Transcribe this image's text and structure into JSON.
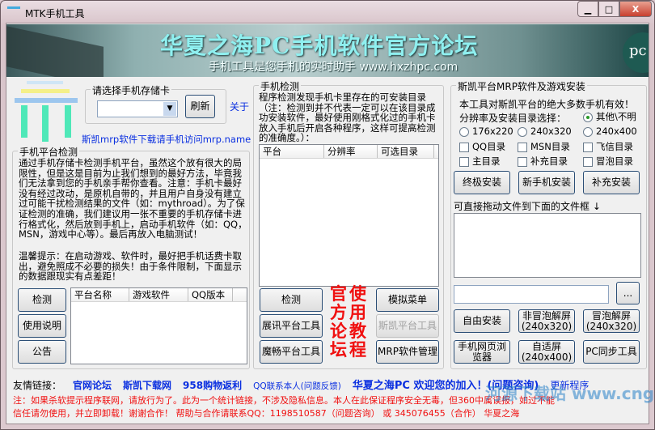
{
  "window": {
    "title": "MTK手机工具",
    "minimize": "▁",
    "maximize": "□",
    "close": "X"
  },
  "banner": {
    "title": "华夏之海PC手机软件官方论坛",
    "subtitle": "手机工具是您手机的实时助手 www.hxzhpc.com",
    "badge": "pc"
  },
  "storage": {
    "label": "请选择手机存储卡",
    "combo_value": "",
    "refresh": "刷新",
    "about": "关于",
    "mrp_link": "斯凯mrp软件下载请手机访问mrp.name"
  },
  "platform": {
    "label": "手机平台检测",
    "description": "通过手机存储卡检测手机平台，虽然这个放有很大的局限性，但是这是目前为止我们想到的最好方法，毕竟我们无法拿到您的手机亲手帮你查看。注意：手机卡最好没有经过改动，是原机自带的，并且用户自身没有建立过可能干扰检测结果的文件（如：mythroad）。为了保证检测的准确，我们建议用一张不重要的手机存储卡进行格式化，然后放到手机上，启动手机软件（如：QQ，MSN，游戏中心等）。最后再放入电脑测试！",
    "tip": "温馨提示：在启动游戏、软件时，最好把手机话费卡取出，避免照成不必要的损失！由于条件限制，下面显示的数据跟现实有点差距！",
    "buttons": [
      "检测",
      "使用说明",
      "公告"
    ],
    "columns": [
      "平台名称",
      "游戏软件",
      "QQ版本"
    ]
  },
  "detect": {
    "label": "手机检测",
    "description": "程序检测发现手机卡里存在的可安装目录（注：检测到并不代表一定可以在该目录成功安装软件，最好使用刚格式化过的手机卡放入手机后开启各种程序，这样可提高检测的准确度。）：",
    "columns": [
      "平台",
      "分辨率",
      "可选目录"
    ],
    "buttons": [
      "检测",
      "展讯平台工具",
      "魔畅平台工具"
    ],
    "tutorial_col1": "官方论坛",
    "tutorial_col2": "使用教程",
    "right_buttons": [
      "模拟菜单",
      "斯凯平台工具",
      "MRP软件管理"
    ]
  },
  "mrp": {
    "label": "斯凯平台MRP软件及游戏安装",
    "intro": "本工具对斯凯平台的绝大多数手机有效！",
    "res_label": "分辨率及安装目录选择：",
    "radios": [
      {
        "label": "其他\\不明",
        "checked": true
      },
      {
        "label": "176x220",
        "checked": false
      },
      {
        "label": "240x320",
        "checked": false
      },
      {
        "label": "240x400",
        "checked": false
      }
    ],
    "checkboxes": [
      {
        "label": "QQ目录",
        "checked": false
      },
      {
        "label": "MSN目录",
        "checked": false
      },
      {
        "label": "飞信目录",
        "checked": false
      },
      {
        "label": "主目录",
        "checked": false
      },
      {
        "label": "补充目录",
        "checked": false
      },
      {
        "label": "冒泡目录",
        "checked": false
      }
    ],
    "install_buttons": [
      "终极安装",
      "新手机安装",
      "补充安装"
    ],
    "drop_label": "可直接拖动文件到下面的文件框 ↓",
    "file_path": "",
    "browse": "...",
    "bottom_buttons": [
      "自由安装",
      "非冒泡解屏(240x320)",
      "冒泡解屏(240x320)",
      "手机网页浏览器",
      "自适屏(240x400)",
      "PC同步工具"
    ]
  },
  "footer": {
    "links_label": "友情链接：",
    "links": [
      "官网论坛",
      "斯凯下载网",
      "958购物返利",
      "QQ联系本人(问题反馈)",
      "华夏之海PC  欢迎您的加入！(问题咨询)",
      "更新程序"
    ],
    "notice1": "注：如果杀软提示程序联网，请放行为了。此为一个统计链接，不涉及隐私信息。本人在此保证程序安全无毒，但360中属误报，如过不能",
    "notice2": "信任请勿使用，并立即卸载！谢谢合作！   帮助与合作请联系QQ：1198510587（问题咨询） 或 345076455（合作）   华夏之海",
    "watermark": "河源下载站 www.cngr.cn"
  }
}
